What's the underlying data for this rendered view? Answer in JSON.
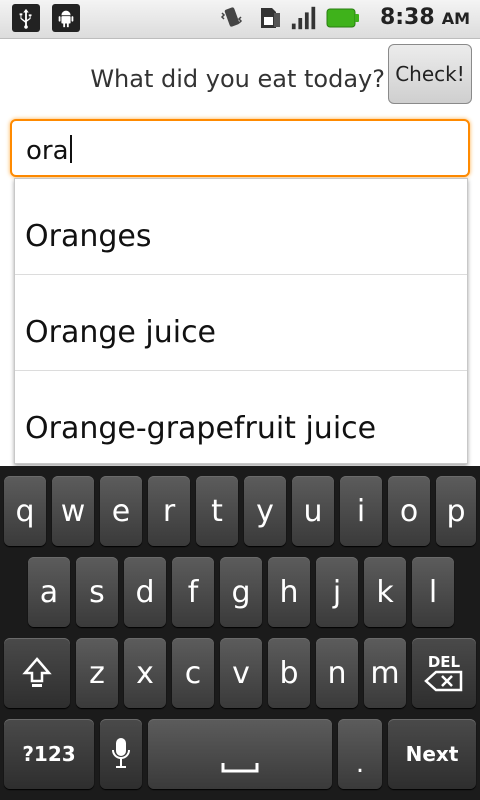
{
  "status_bar": {
    "time": "8:38",
    "ampm": "AM",
    "icons": [
      "usb-icon",
      "android-debug-icon",
      "vibrate-icon",
      "sim-icon",
      "signal-icon",
      "battery-icon"
    ]
  },
  "prompt": {
    "question": "What did you eat today?",
    "check_label": "Check!"
  },
  "input": {
    "value": "ora"
  },
  "suggestions": [
    "Oranges",
    "Orange juice",
    "Orange-grapefruit juice"
  ],
  "keyboard": {
    "row1": [
      "q",
      "w",
      "e",
      "r",
      "t",
      "y",
      "u",
      "i",
      "o",
      "p"
    ],
    "row2": [
      "a",
      "s",
      "d",
      "f",
      "g",
      "h",
      "j",
      "k",
      "l"
    ],
    "row3": [
      "z",
      "x",
      "c",
      "v",
      "b",
      "n",
      "m"
    ],
    "del_label": "DEL",
    "symbols_label": "?123",
    "period_label": ".",
    "next_label": "Next"
  },
  "colors": {
    "focus": "#ff8a00",
    "battery": "#3fb21b"
  }
}
